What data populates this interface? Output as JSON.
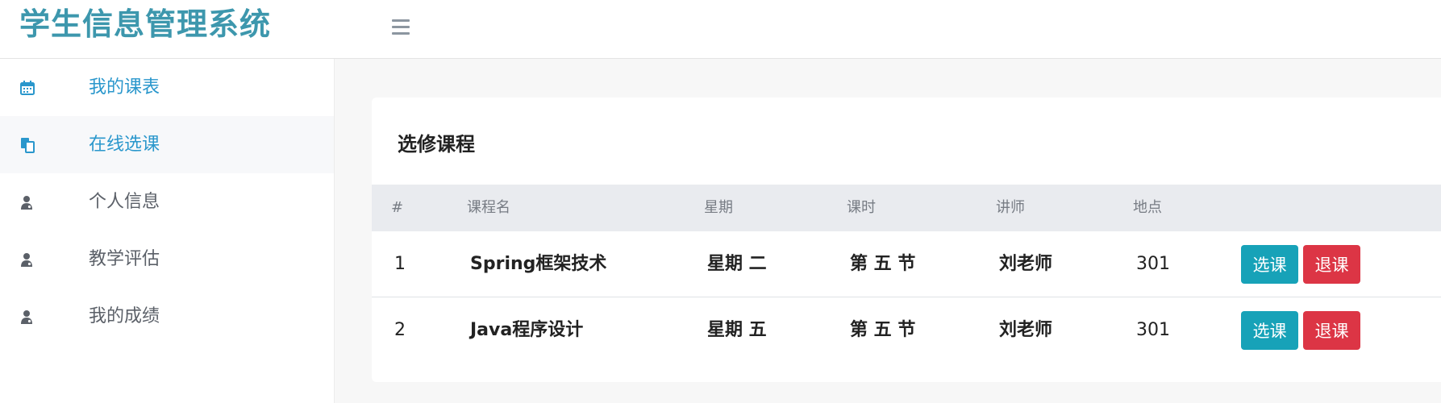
{
  "header": {
    "brand": "学生信息管理系统"
  },
  "sidebar": {
    "items": [
      {
        "label": "我的课表",
        "icon": "calendar-icon"
      },
      {
        "label": "在线选课",
        "icon": "copy-icon"
      },
      {
        "label": "个人信息",
        "icon": "user-md-icon"
      },
      {
        "label": "教学评估",
        "icon": "user-md-icon"
      },
      {
        "label": "我的成绩",
        "icon": "user-md-icon"
      }
    ]
  },
  "main": {
    "title": "选修课程",
    "columns": [
      "#",
      "课程名",
      "星期",
      "课时",
      "讲师",
      "地点"
    ],
    "rows": [
      {
        "num": "1",
        "course": "Spring框架技术",
        "day": "星期 二",
        "period": "第 五 节",
        "teacher": "刘老师",
        "room": "301",
        "select_label": "选课",
        "drop_label": "退课"
      },
      {
        "num": "2",
        "course": "Java程序设计",
        "day": "星期 五",
        "period": "第 五 节",
        "teacher": "刘老师",
        "room": "301",
        "select_label": "选课",
        "drop_label": "退课"
      }
    ]
  },
  "colors": {
    "brand": "#3d97ad",
    "nav_active": "#2a97cc",
    "select_button": "#17a2b8",
    "drop_button": "#dc3545"
  }
}
